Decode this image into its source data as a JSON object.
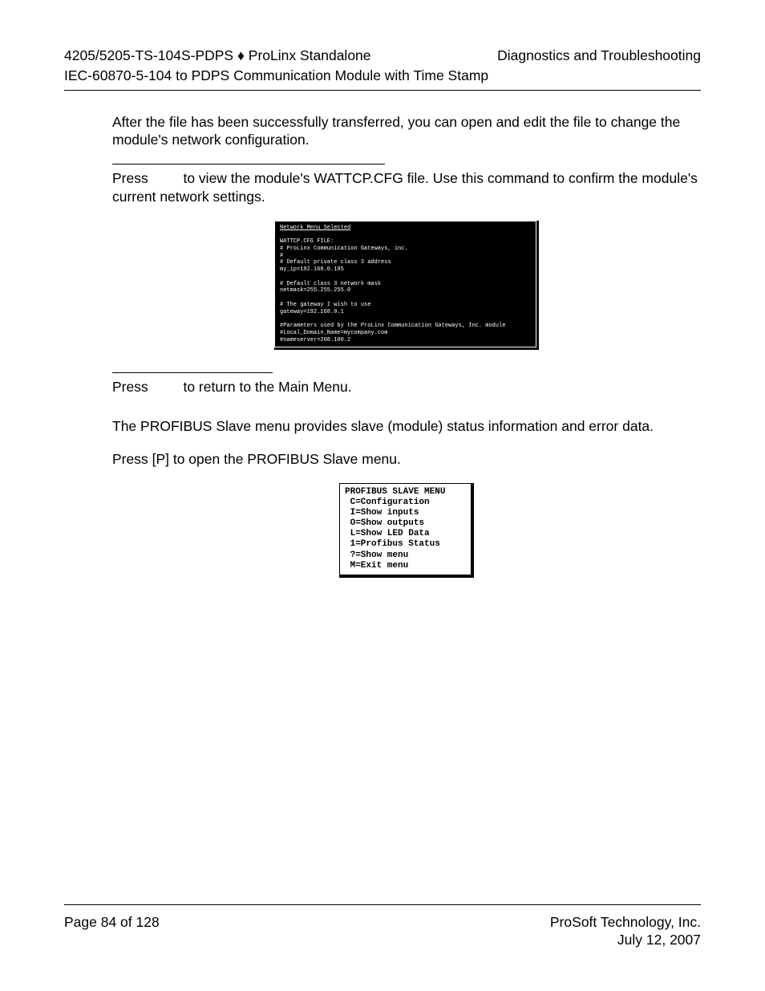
{
  "header": {
    "left_line1_a": "4205/5205-TS-104S-PDPS ",
    "diamond": "♦",
    "left_line1_b": " ProLinx Standalone",
    "right_line1": "Diagnostics and Troubleshooting",
    "sub": "IEC-60870-5-104 to PDPS Communication Module with Time Stamp"
  },
  "body": {
    "para1": "After the file has been successfully transferred, you can open and edit the file to change the module's network configuration.",
    "press1_a": "Press ",
    "press1_b": " to view the module's WATTCP.CFG file. Use this command to confirm the module's current network settings.",
    "press2_a": "Press ",
    "press2_b": " to return to the Main Menu.",
    "para2": "The PROFIBUS Slave menu provides slave (module) status information and error data.",
    "para3": "Press [P] to open the PROFIBUS Slave menu."
  },
  "terminal1": {
    "title": "Network Menu Selected",
    "lines": [
      "WATTCP.CFG FILE:",
      "# ProLinx Communication Gateways, inc.",
      "#",
      "# Default private class 3 address",
      "my_ip=192.168.0.185",
      "",
      "# Default class 3 network mask",
      "netmask=255.255.255.0",
      "",
      "# The gateway I wish to use",
      "gateway=192.168.0.1",
      "",
      "#Parameters used by the ProLinx Communication Gateways, Inc. module",
      "#Local_Domain_Name=mycompany.com",
      "#nameserver=208.100.2"
    ]
  },
  "terminal2": {
    "lines": [
      "PROFIBUS SLAVE MENU",
      " C=Configuration",
      " I=Show inputs",
      " O=Show outputs",
      " L=Show LED Data",
      " 1=Profibus Status",
      " ?=Show menu",
      " M=Exit menu"
    ]
  },
  "footer": {
    "left": "Page 84 of 128",
    "right1": "ProSoft Technology, Inc.",
    "right2": "July 12, 2007"
  }
}
